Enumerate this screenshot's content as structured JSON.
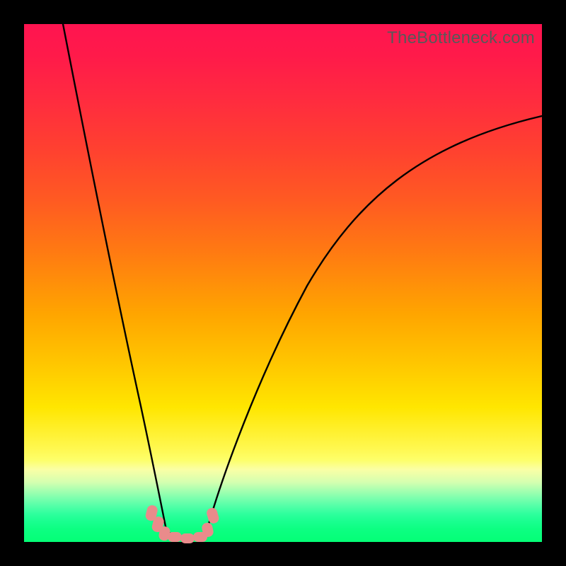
{
  "watermark": "TheBottleneck.com",
  "colors": {
    "frame": "#000000",
    "curve": "#000000",
    "marker_fill": "#e98b8b",
    "marker_stroke": "#e98b8b"
  },
  "chart_data": {
    "type": "line",
    "title": "",
    "xlabel": "",
    "ylabel": "",
    "xlim": [
      0,
      100
    ],
    "ylim": [
      0,
      100
    ],
    "grid": false,
    "legend": false,
    "note": "No axis ticks or numeric labels are rendered in the image; values below are estimated from pixel geometry on a 0–100 scale for both axes.",
    "series": [
      {
        "name": "left-branch",
        "x": [
          7.5,
          10,
          13,
          16,
          19,
          22,
          25,
          27
        ],
        "y": [
          100,
          78,
          57,
          39,
          24,
          12,
          4,
          0.6
        ]
      },
      {
        "name": "flat-bottom",
        "x": [
          27,
          29,
          31,
          33,
          35
        ],
        "y": [
          0.6,
          0.4,
          0.35,
          0.4,
          0.6
        ]
      },
      {
        "name": "right-branch",
        "x": [
          35,
          40,
          46,
          53,
          61,
          70,
          80,
          90,
          100
        ],
        "y": [
          0.6,
          10,
          24,
          38,
          51,
          62,
          71,
          78,
          82
        ]
      }
    ],
    "markers": {
      "name": "highlighted-points",
      "shape": "rounded-rect",
      "x": [
        24.5,
        25.8,
        27.2,
        29.0,
        31.4,
        33.8,
        35.4,
        36.4
      ],
      "y": [
        5.0,
        3.0,
        1.4,
        0.7,
        0.5,
        0.7,
        2.4,
        5.4
      ]
    }
  }
}
